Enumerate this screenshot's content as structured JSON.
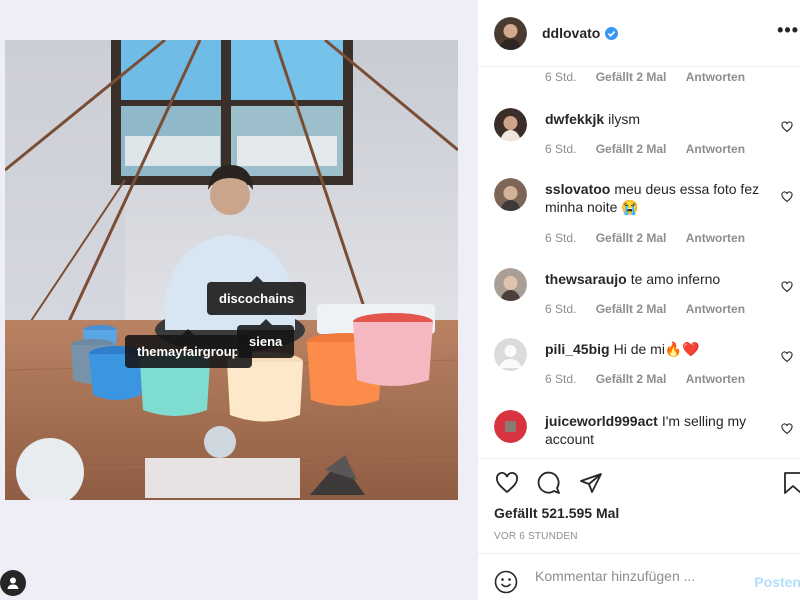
{
  "media": {
    "tags": [
      "discochains",
      "themayfairgroup",
      "siena"
    ]
  },
  "header": {
    "username": "ddlovato",
    "more_icon": "more-horizontal-icon"
  },
  "top_comment_meta": {
    "time": "6 Std.",
    "likes": "Gefällt 2 Mal",
    "reply": "Antworten"
  },
  "comments": [
    {
      "username": "dwfekkjk",
      "text": "ilysm",
      "time": "6 Std.",
      "likes": "Gefällt 2 Mal",
      "reply": "Antworten"
    },
    {
      "username": "sslovatoo",
      "text": "meu deus essa foto fez minha noite 😭",
      "time": "6 Std.",
      "likes": "Gefällt 2 Mal",
      "reply": "Antworten"
    },
    {
      "username": "thewsaraujo",
      "text": "te amo inferno",
      "time": "6 Std.",
      "likes": "Gefällt 2 Mal",
      "reply": "Antworten"
    },
    {
      "username": "pili_45big",
      "text": "Hi de mi🔥❤️",
      "time": "6 Std.",
      "likes": "Gefällt 2 Mal",
      "reply": "Antworten"
    },
    {
      "username": "juiceworld999act",
      "text": "I'm selling my account"
    }
  ],
  "post": {
    "likes": "Gefällt 521.595 Mal",
    "time": "VOR 6 STUNDEN"
  },
  "add_comment": {
    "placeholder": "Kommentar hinzufügen ...",
    "post_label": "Posten"
  },
  "colors": {
    "verified": "#3897f0",
    "link": "#b2dffc",
    "muted": "#8e8e8e"
  }
}
